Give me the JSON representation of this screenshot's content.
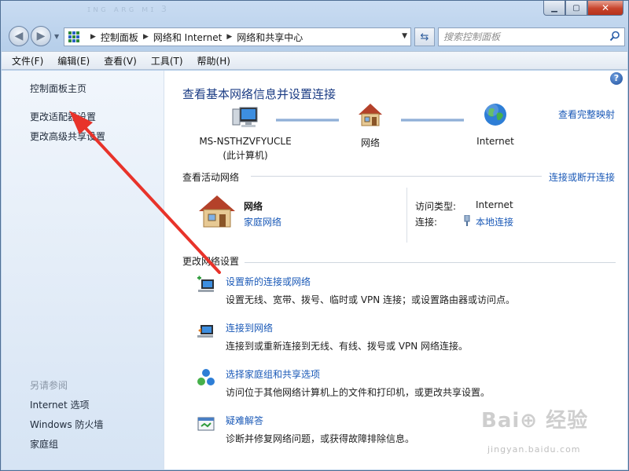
{
  "window": {
    "title_ghost": "ɪɴɢ  ᴀʀɢ ᴍɪ 3",
    "minimize_icon": "minimize-icon",
    "maximize_icon": "maximize-icon",
    "close_icon": "close-icon"
  },
  "navbar": {
    "breadcrumbs": [
      "控制面板",
      "网络和 Internet",
      "网络和共享中心"
    ],
    "search_placeholder": "搜索控制面板"
  },
  "menubar": {
    "items": [
      "文件(F)",
      "编辑(E)",
      "查看(V)",
      "工具(T)",
      "帮助(H)"
    ]
  },
  "sidebar": {
    "links": [
      "控制面板主页",
      "更改适配器设置",
      "更改高级共享设置"
    ],
    "see_also_heading": "另请参阅",
    "see_also": [
      "Internet 选项",
      "Windows 防火墙",
      "家庭组"
    ]
  },
  "main": {
    "title": "查看基本网络信息并设置连接",
    "full_map_link": "查看完整映射",
    "network_map": {
      "computer_name": "MS-NSTHZVFYUCLE",
      "computer_sub": "(此计算机)",
      "network": "网络",
      "internet": "Internet"
    },
    "active_networks": {
      "label": "查看活动网络",
      "connect_link": "连接或断开连接",
      "network_name": "网络",
      "network_type": "家庭网络",
      "access_type_label": "访问类型:",
      "access_type_value": "Internet",
      "connection_label": "连接:",
      "connection_value": "本地连接"
    },
    "change_settings": {
      "label": "更改网络设置",
      "tasks": [
        {
          "title": "设置新的连接或网络",
          "desc": "设置无线、宽带、拨号、临时或 VPN 连接；或设置路由器或访问点。",
          "icon": "new-connection-icon"
        },
        {
          "title": "连接到网络",
          "desc": "连接到或重新连接到无线、有线、拨号或 VPN 网络连接。",
          "icon": "connect-network-icon"
        },
        {
          "title": "选择家庭组和共享选项",
          "desc": "访问位于其他网络计算机上的文件和打印机，或更改共享设置。",
          "icon": "homegroup-icon"
        },
        {
          "title": "疑难解答",
          "desc": "诊断并修复网络问题，或获得故障排除信息。",
          "icon": "troubleshoot-icon"
        }
      ]
    }
  },
  "watermark": {
    "text": "Bai⊕ 经验",
    "sub": "jingyan.baidu.com"
  },
  "colors": {
    "link": "#1a59b7",
    "title": "#1b3c84",
    "arrow": "#e8332a"
  }
}
